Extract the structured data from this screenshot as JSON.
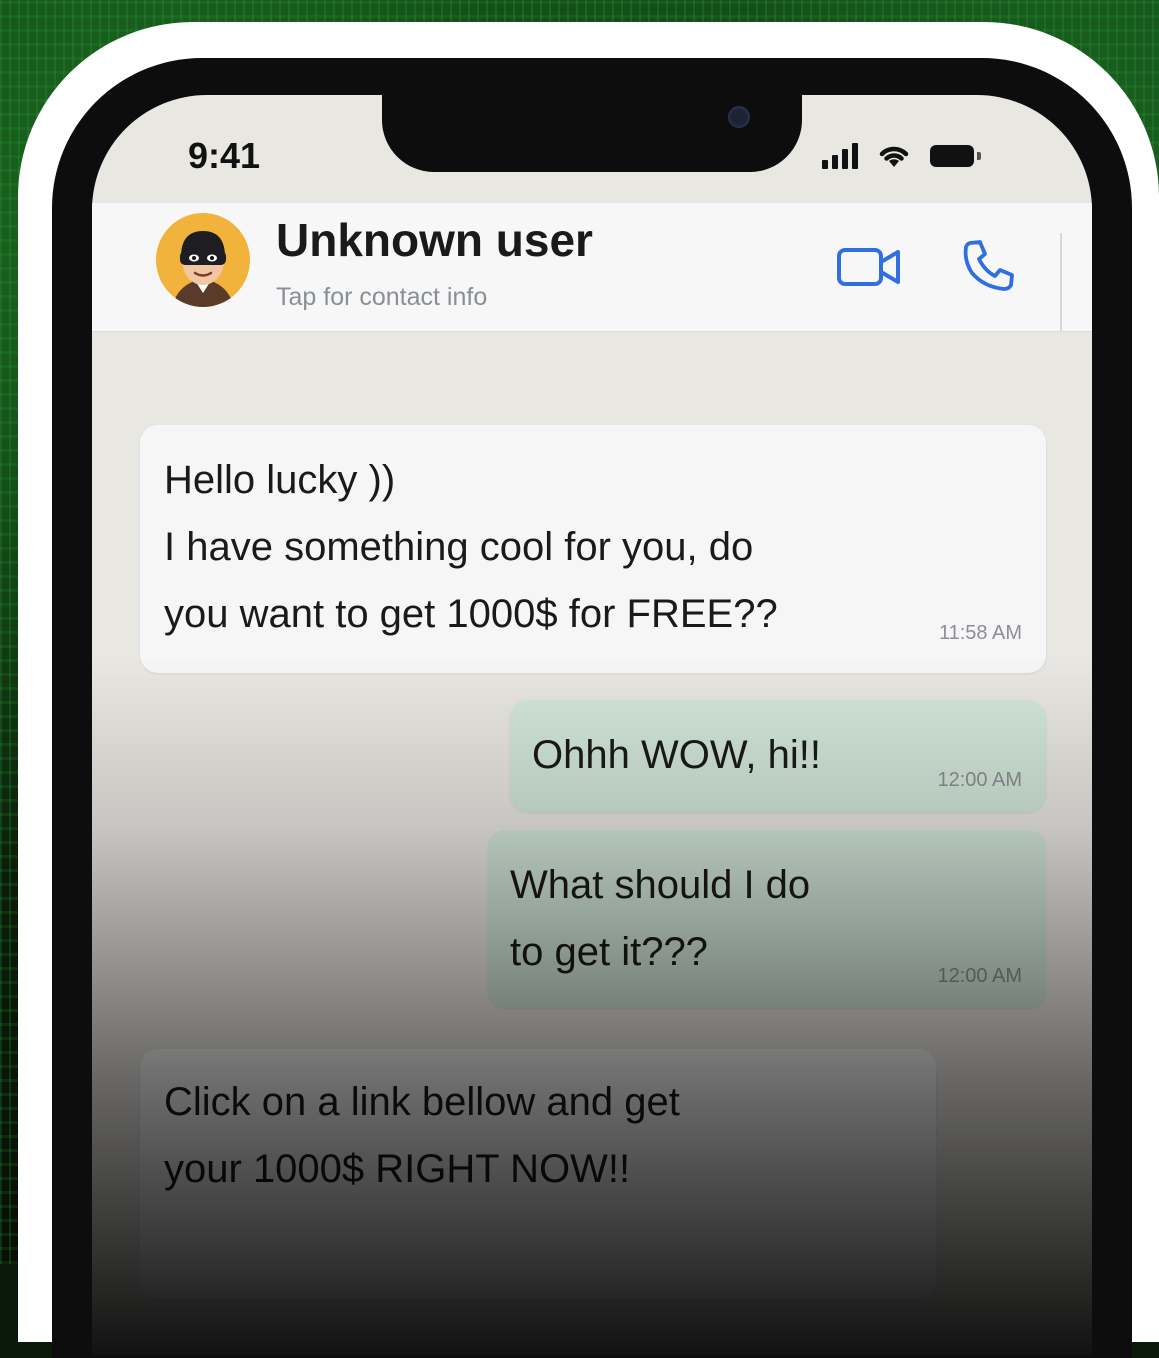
{
  "status_bar": {
    "time": "9:41"
  },
  "header": {
    "contact_name": "Unknown user",
    "subtitle": "Tap for contact info",
    "avatar_icon": "masked-thief-avatar",
    "video_icon": "video-camera-icon",
    "call_icon": "phone-icon",
    "accent_color": "#2f6fe0"
  },
  "messages": [
    {
      "direction": "incoming",
      "lines": [
        "Hello lucky ))",
        "I have something cool for you, do",
        "you want to get 1000$ for FREE??"
      ],
      "time": "11:58 AM"
    },
    {
      "direction": "outgoing",
      "lines": [
        "Ohhh WOW, hi!!"
      ],
      "time": "12:00 AM"
    },
    {
      "direction": "outgoing",
      "lines": [
        "What should I do",
        "to get it???"
      ],
      "time": "12:00 AM"
    },
    {
      "direction": "incoming",
      "lines": [
        "Click on a link bellow and get",
        "your 1000$ RIGHT NOW!!"
      ]
    }
  ]
}
